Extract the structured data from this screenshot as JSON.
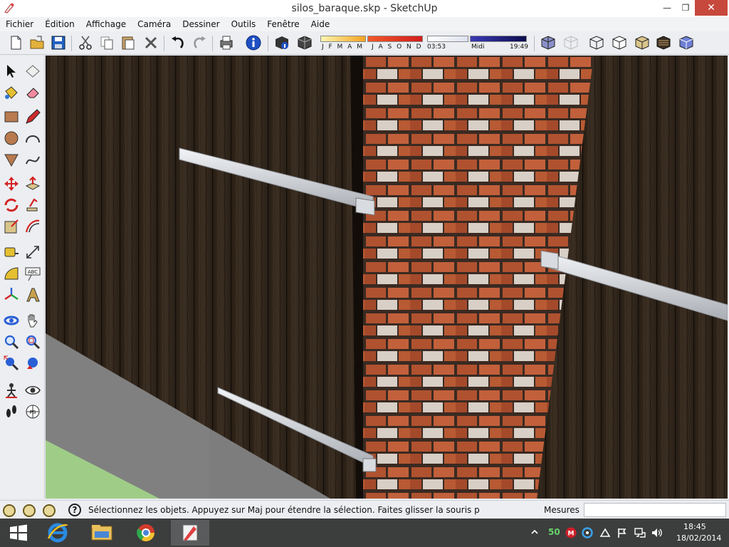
{
  "window": {
    "title": "silos_baraque.skp - SketchUp",
    "minimize_glyph": "—",
    "maximize_glyph": "❐",
    "close_glyph": "✕"
  },
  "menu": [
    "Fichier",
    "Édition",
    "Affichage",
    "Caméra",
    "Dessiner",
    "Outils",
    "Fenêtre",
    "Aide"
  ],
  "shadow_settings": {
    "months_left": "J F M A M",
    "months_right": "J A S O N D",
    "time_start": "03:53",
    "time_mid": "Midi",
    "time_end": "19:49"
  },
  "status": {
    "text": "Sélectionnez les objets. Appuyez sur Maj pour étendre la sélection. Faites glisser la souris pou",
    "measures_label": "Mesures",
    "measures_value": ""
  },
  "taskbar": {
    "tray_counter": "50",
    "time": "18:45",
    "date": "18/02/2014"
  },
  "colors": {
    "accent_close": "#c7483c",
    "wood_dark": "#2a2016",
    "brick": "#a94a2c",
    "taskbar": "#3c3d3d"
  }
}
